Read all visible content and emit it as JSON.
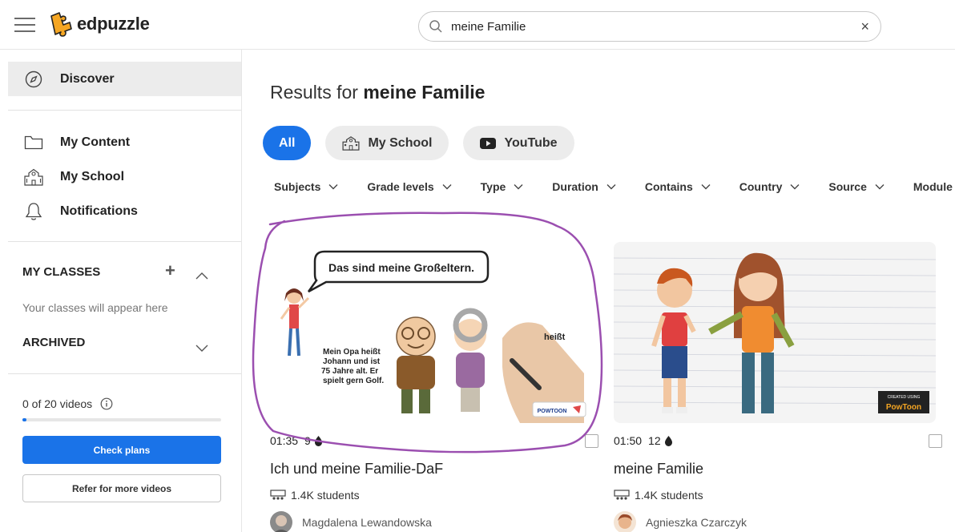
{
  "app": {
    "name": "edpuzzle"
  },
  "search": {
    "value": "meine Familie",
    "placeholder": ""
  },
  "sidebar": {
    "discover": "Discover",
    "items": [
      {
        "label": "My Content",
        "icon": "folder-icon"
      },
      {
        "label": "My School",
        "icon": "school-icon"
      },
      {
        "label": "Notifications",
        "icon": "bell-icon"
      }
    ],
    "my_classes": "MY CLASSES",
    "classes_hint": "Your classes will appear here",
    "archived": "ARCHIVED",
    "quota_text": "0 of 20 videos",
    "quota_fraction": 0.02,
    "check_plans": "Check plans",
    "refer": "Refer for more videos"
  },
  "main": {
    "results_prefix": "Results for",
    "results_query": "meine Familie",
    "chips": [
      {
        "label": "All",
        "active": true
      },
      {
        "label": "My School",
        "icon": "school-icon"
      },
      {
        "label": "YouTube",
        "icon": "youtube-icon"
      }
    ],
    "filters": [
      "Subjects",
      "Grade levels",
      "Type",
      "Duration",
      "Contains",
      "Country",
      "Source",
      "Module"
    ],
    "videos": [
      {
        "duration": "01:35",
        "questions": "9",
        "title": "Ich und meine Familie-DaF",
        "students": "1.4K students",
        "author": "Magdalena Lewandowska",
        "thumb_caption": "Das sind meine Großeltern.",
        "thumb_text": [
          "Mein Opa heißt",
          "Johann und ist",
          "75 Jahre alt. Er",
          "spielt gern Golf."
        ],
        "thumb_word": "heißt",
        "thumb_brand": "POWTOON"
      },
      {
        "duration": "01:50",
        "questions": "12",
        "title": "meine Familie",
        "students": "1.4K students",
        "author": "Agnieszka Czarczyk",
        "thumb_brand": "PowToon",
        "thumb_brand_small": "CREATED USING"
      }
    ]
  },
  "colors": {
    "primary": "#1a73e8",
    "annotation": "#9b4fb0"
  }
}
